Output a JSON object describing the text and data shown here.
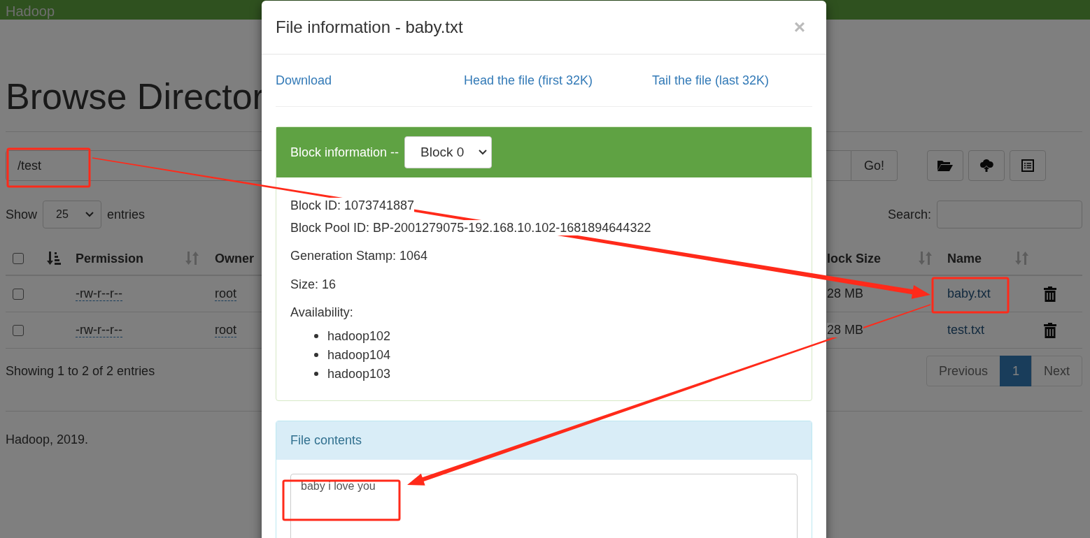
{
  "navbar": {
    "brand": "Hadoop"
  },
  "page": {
    "title": "Browse Director",
    "path": "/test",
    "go_button": "Go!",
    "show_label": "Show",
    "page_size": "25",
    "entries_label": "entries",
    "search_label": "Search:",
    "table": {
      "header_checked": false,
      "columns": [
        "Permission",
        "Owner",
        "lock Size",
        "Name"
      ],
      "rows": [
        {
          "checked": false,
          "permission": "-rw-r--r--",
          "owner": "root",
          "block_size": "28 MB",
          "name": "baby.txt"
        },
        {
          "checked": false,
          "permission": "-rw-r--r--",
          "owner": "root",
          "block_size": "28 MB",
          "name": "test.txt"
        }
      ]
    },
    "summary": "Showing 1 to 2 of 2 entries",
    "pagination": [
      {
        "label": "Previous",
        "selected": false
      },
      {
        "label": "1",
        "selected": true
      },
      {
        "label": "Next",
        "selected": false
      }
    ]
  },
  "footer": "Hadoop, 2019.",
  "modal": {
    "title": "File information - baby.txt",
    "close": "×",
    "links": [
      "Download",
      "Head the file (first 32K)",
      "Tail the file (last 32K)"
    ],
    "block_panel": {
      "heading": "Block information --",
      "block_select": "Block 0",
      "fields": [
        "Block ID: 1073741887",
        "Block Pool ID: BP-2001279075-192.168.10.102-1681894644322",
        "Generation Stamp: 1064",
        "Size: 16"
      ],
      "availability_label": "Availability:",
      "hosts": [
        "hadoop102",
        "hadoop104",
        "hadoop103"
      ]
    },
    "contents_panel": {
      "heading": "File contents",
      "text": "baby i love you"
    }
  }
}
